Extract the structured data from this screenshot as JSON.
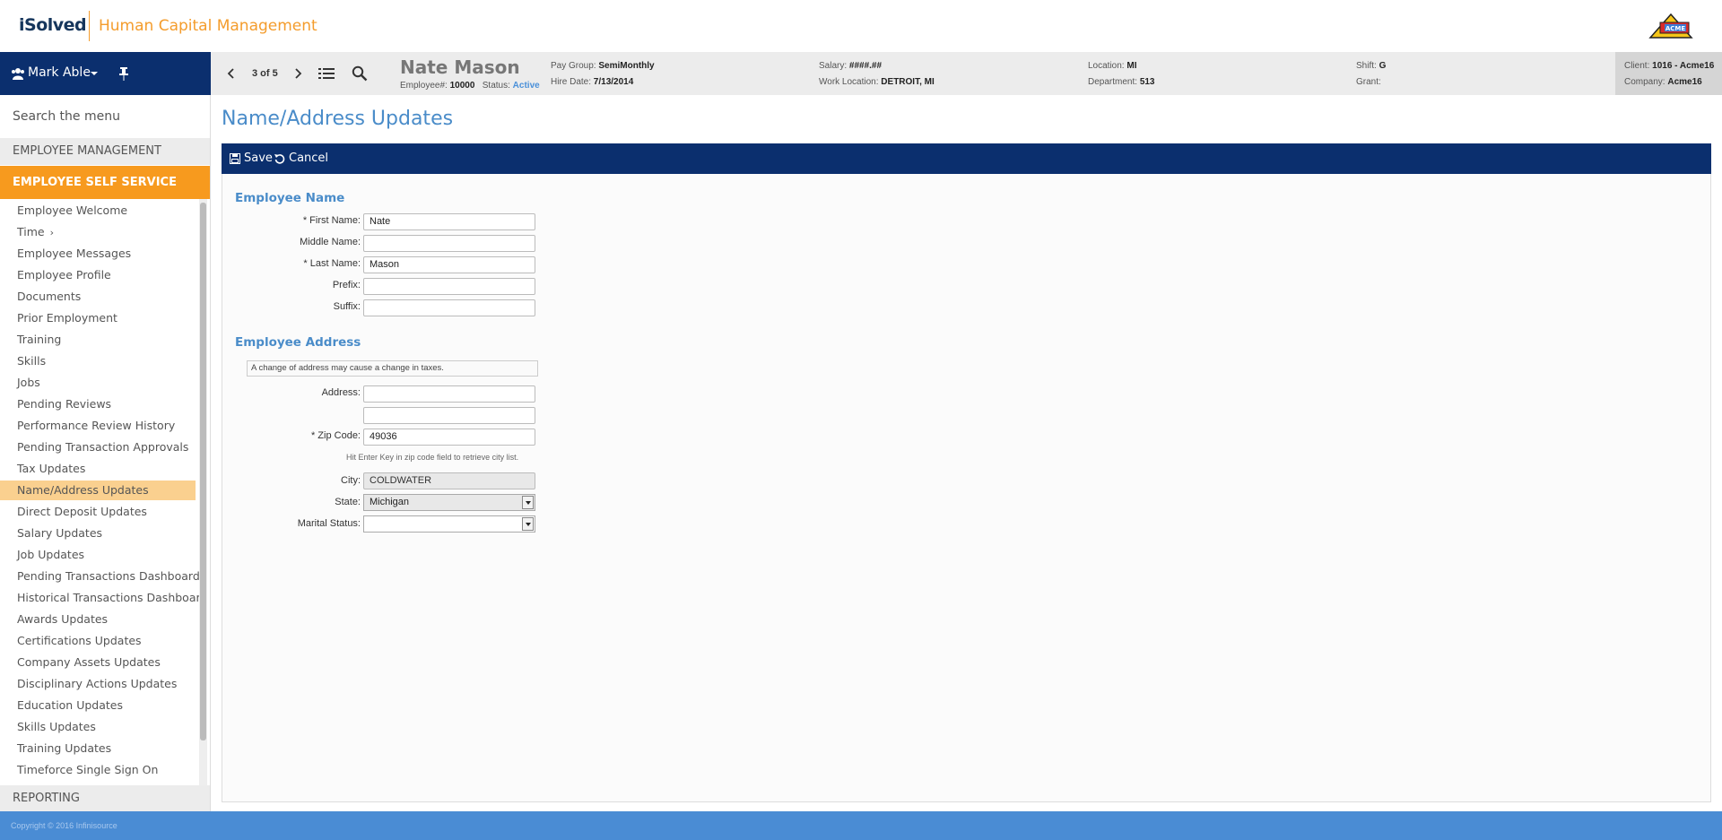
{
  "header": {
    "logo_text": "iSolved",
    "app_title": "Human Capital Management",
    "company_logo_text": "ACME"
  },
  "navbar": {
    "user_name": "Mark Able",
    "page_count": "3 of 5",
    "employee": {
      "name": "Nate Mason",
      "number_label": "Employee#:",
      "number": "10000",
      "status_label": "Status:",
      "status": "Active"
    },
    "info": {
      "pay_group_label": "Pay Group:",
      "pay_group": "SemiMonthly",
      "hire_date_label": "Hire Date:",
      "hire_date": "7/13/2014",
      "salary_label": "Salary:",
      "salary": "####.##",
      "work_location_label": "Work Location:",
      "work_location": "DETROIT, MI",
      "location_label": "Location:",
      "location": "MI",
      "department_label": "Department:",
      "department": "513",
      "shift_label": "Shift:",
      "shift": "G",
      "grant_label": "Grant:",
      "grant": "",
      "client_label": "Client:",
      "client": "1016 - Acme16",
      "company_label": "Company:",
      "company": "Acme16"
    }
  },
  "sidebar": {
    "search_placeholder": "Search the menu",
    "section_employee_management": "EMPLOYEE MANAGEMENT",
    "section_ess": "EMPLOYEE SELF SERVICE",
    "section_reporting": "REPORTING",
    "items": [
      {
        "label": "Employee Welcome"
      },
      {
        "label": "Time",
        "chevron": "›"
      },
      {
        "label": "Employee Messages"
      },
      {
        "label": "Employee Profile"
      },
      {
        "label": "Documents"
      },
      {
        "label": "Prior Employment"
      },
      {
        "label": "Training"
      },
      {
        "label": "Skills"
      },
      {
        "label": "Jobs"
      },
      {
        "label": "Pending Reviews"
      },
      {
        "label": "Performance Review History"
      },
      {
        "label": "Pending Transaction Approvals"
      },
      {
        "label": "Tax Updates"
      },
      {
        "label": "Name/Address Updates",
        "selected": true
      },
      {
        "label": "Direct Deposit Updates"
      },
      {
        "label": "Salary Updates"
      },
      {
        "label": "Job Updates"
      },
      {
        "label": "Pending Transactions Dashboard"
      },
      {
        "label": "Historical Transactions Dashboard"
      },
      {
        "label": "Awards Updates"
      },
      {
        "label": "Certifications Updates"
      },
      {
        "label": "Company Assets Updates"
      },
      {
        "label": "Disciplinary Actions Updates"
      },
      {
        "label": "Education Updates"
      },
      {
        "label": "Skills Updates"
      },
      {
        "label": "Training Updates"
      },
      {
        "label": "Timeforce Single Sign On"
      }
    ]
  },
  "main": {
    "title": "Name/Address Updates",
    "toolbar": {
      "save_label": "Save",
      "cancel_label": "Cancel"
    },
    "name_section": {
      "title": "Employee Name",
      "first_name_label": "First Name:",
      "first_name": "Nate",
      "middle_name_label": "Middle Name:",
      "middle_name": "",
      "last_name_label": "Last Name:",
      "last_name": "Mason",
      "prefix_label": "Prefix:",
      "prefix": "",
      "suffix_label": "Suffix:",
      "suffix": ""
    },
    "address_section": {
      "title": "Employee Address",
      "note": "A change of address may cause a change in taxes.",
      "address_label": "Address:",
      "address1": "",
      "address2": "",
      "zip_label": "Zip Code:",
      "zip": "49036",
      "zip_help": "Hit Enter Key in zip code field to retrieve city list.",
      "city_label": "City:",
      "city": "COLDWATER",
      "state_label": "State:",
      "state": "Michigan",
      "marital_label": "Marital Status:",
      "marital": ""
    },
    "required_marker": "*"
  },
  "footer": {
    "copyright": "Copyright © 2016 Infinisource"
  },
  "colors": {
    "navy": "#0b2f6e",
    "orange": "#f79a1e",
    "accent_blue": "#4a8cc9",
    "selected_item": "#fad08f",
    "footer_blue": "#4a8cd4"
  }
}
